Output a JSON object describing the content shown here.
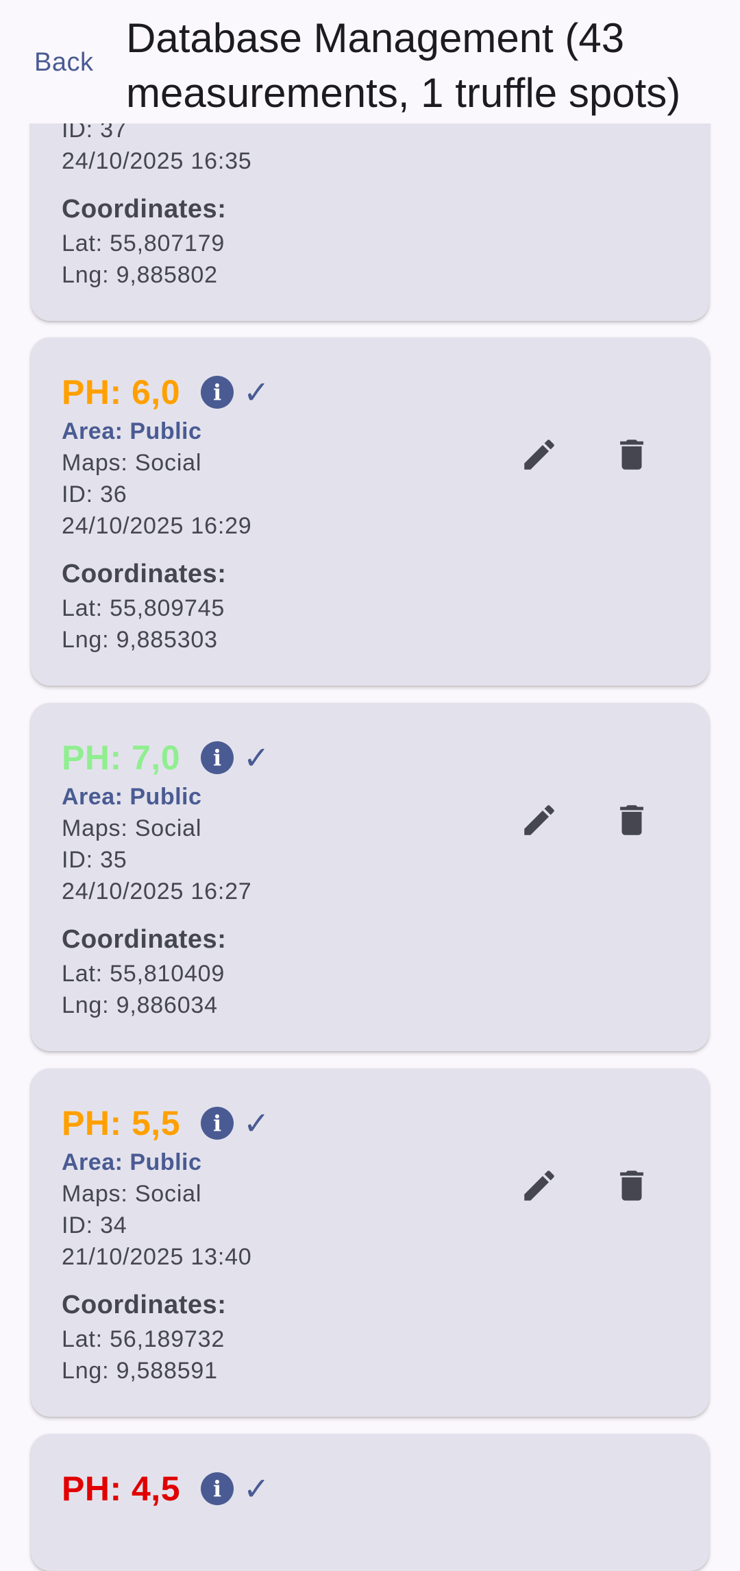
{
  "header": {
    "back_label": "Back",
    "title": "Database Management (43 measurements, 1 truffle spots)"
  },
  "colors": {
    "accent": "#4a5b93",
    "orange": "#ffa000",
    "green": "#90ee90",
    "red": "#e00000",
    "card": "#e3e2ec"
  },
  "labels": {
    "coordinates": "Coordinates:"
  },
  "partial_top_card": {
    "id": "ID: 37",
    "timestamp": "24/10/2025 16:35",
    "lat": "Lat: 55,807179",
    "lng": "Lng: 9,885802"
  },
  "measurements": [
    {
      "ph": "PH: 6,0",
      "ph_color": "#ffa000",
      "area": "Area: Public",
      "maps": "Maps: Social",
      "id": "ID: 36",
      "timestamp": "24/10/2025 16:29",
      "lat": "Lat: 55,809745",
      "lng": "Lng: 9,885303"
    },
    {
      "ph": "PH: 7,0",
      "ph_color": "#90ee90",
      "area": "Area: Public",
      "maps": "Maps: Social",
      "id": "ID: 35",
      "timestamp": "24/10/2025 16:27",
      "lat": "Lat: 55,810409",
      "lng": "Lng: 9,886034"
    },
    {
      "ph": "PH: 5,5",
      "ph_color": "#ffa000",
      "area": "Area: Public",
      "maps": "Maps: Social",
      "id": "ID: 34",
      "timestamp": "21/10/2025 13:40",
      "lat": "Lat: 56,189732",
      "lng": "Lng: 9,588591"
    }
  ],
  "partial_bottom_card": {
    "ph": "PH: 4,5",
    "ph_color": "#e00000"
  },
  "icons": {
    "info": "info-icon",
    "check": "check-icon",
    "edit": "pencil-icon",
    "delete": "trash-icon"
  }
}
